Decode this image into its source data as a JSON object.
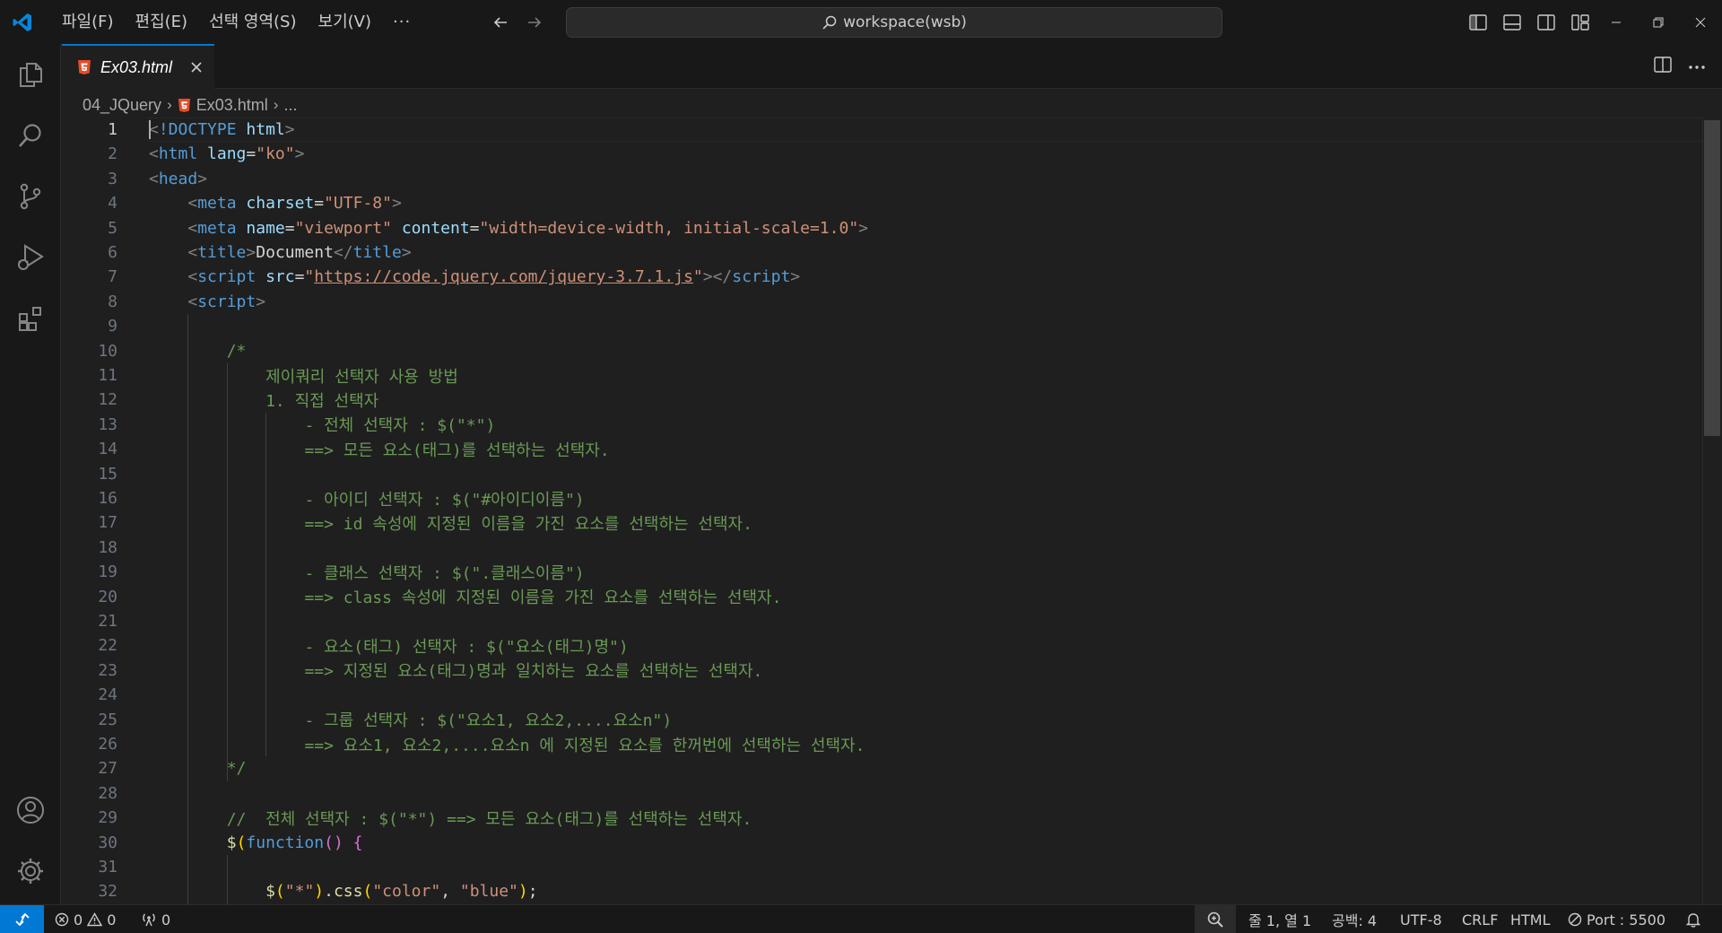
{
  "menu": {
    "items": [
      "파일(F)",
      "편집(E)",
      "선택 영역(S)",
      "보기(V)"
    ],
    "more": "···"
  },
  "command_center": {
    "text": "workspace(wsb)"
  },
  "tab": {
    "label": "Ex03.html"
  },
  "breadcrumb": {
    "folder": "04_JQuery",
    "file": "Ex03.html",
    "tail": "..."
  },
  "editor": {
    "lines": [
      {
        "n": "1",
        "indent": 0,
        "tokens": [
          [
            "punc",
            "<"
          ],
          [
            "tag",
            "!DOCTYPE "
          ],
          [
            "attr",
            "html"
          ],
          [
            "punc",
            ">"
          ]
        ]
      },
      {
        "n": "2",
        "indent": 0,
        "tokens": [
          [
            "punc",
            "<"
          ],
          [
            "tag",
            "html "
          ],
          [
            "attr",
            "lang"
          ],
          [
            "txt",
            "="
          ],
          [
            "str",
            "\"ko\""
          ],
          [
            "punc",
            ">"
          ]
        ]
      },
      {
        "n": "3",
        "indent": 0,
        "tokens": [
          [
            "punc",
            "<"
          ],
          [
            "tag",
            "head"
          ],
          [
            "punc",
            ">"
          ]
        ]
      },
      {
        "n": "4",
        "indent": 4,
        "tokens": [
          [
            "punc",
            "<"
          ],
          [
            "tag",
            "meta "
          ],
          [
            "attr",
            "charset"
          ],
          [
            "txt",
            "="
          ],
          [
            "str",
            "\"UTF-8\""
          ],
          [
            "punc",
            ">"
          ]
        ]
      },
      {
        "n": "5",
        "indent": 4,
        "tokens": [
          [
            "punc",
            "<"
          ],
          [
            "tag",
            "meta "
          ],
          [
            "attr",
            "name"
          ],
          [
            "txt",
            "="
          ],
          [
            "str",
            "\"viewport\" "
          ],
          [
            "attr",
            "content"
          ],
          [
            "txt",
            "="
          ],
          [
            "str",
            "\"width=device-width, initial-scale=1.0\""
          ],
          [
            "punc",
            ">"
          ]
        ]
      },
      {
        "n": "6",
        "indent": 4,
        "tokens": [
          [
            "punc",
            "<"
          ],
          [
            "tag",
            "title"
          ],
          [
            "punc",
            ">"
          ],
          [
            "txt",
            "Document"
          ],
          [
            "punc",
            "</"
          ],
          [
            "tag",
            "title"
          ],
          [
            "punc",
            ">"
          ]
        ]
      },
      {
        "n": "7",
        "indent": 4,
        "tokens": [
          [
            "punc",
            "<"
          ],
          [
            "tag",
            "script "
          ],
          [
            "attr",
            "src"
          ],
          [
            "txt",
            "="
          ],
          [
            "str",
            "\""
          ],
          [
            "link",
            "https://code.jquery.com/jquery-3.7.1.js"
          ],
          [
            "str",
            "\""
          ],
          [
            "punc",
            "></"
          ],
          [
            "tag",
            "script"
          ],
          [
            "punc",
            ">"
          ]
        ]
      },
      {
        "n": "8",
        "indent": 4,
        "tokens": [
          [
            "punc",
            "<"
          ],
          [
            "tag",
            "script"
          ],
          [
            "punc",
            ">"
          ]
        ]
      },
      {
        "n": "9",
        "indent": 0,
        "tokens": []
      },
      {
        "n": "10",
        "indent": 8,
        "tokens": [
          [
            "cmt",
            "/*"
          ]
        ]
      },
      {
        "n": "11",
        "indent": 12,
        "tokens": [
          [
            "cmt",
            "제이쿼리 선택자 사용 방법"
          ]
        ]
      },
      {
        "n": "12",
        "indent": 12,
        "tokens": [
          [
            "cmt",
            "1. 직접 선택자"
          ]
        ]
      },
      {
        "n": "13",
        "indent": 16,
        "tokens": [
          [
            "cmt",
            "- 전체 선택자 : $(\"*\")"
          ]
        ]
      },
      {
        "n": "14",
        "indent": 16,
        "tokens": [
          [
            "cmt",
            "==> 모든 요소(태그)를 선택하는 선택자."
          ]
        ]
      },
      {
        "n": "15",
        "indent": 0,
        "tokens": []
      },
      {
        "n": "16",
        "indent": 16,
        "tokens": [
          [
            "cmt",
            "- 아이디 선택자 : $(\"#아이디이름\")"
          ]
        ]
      },
      {
        "n": "17",
        "indent": 16,
        "tokens": [
          [
            "cmt",
            "==> id 속성에 지정된 이름을 가진 요소를 선택하는 선택자."
          ]
        ]
      },
      {
        "n": "18",
        "indent": 0,
        "tokens": []
      },
      {
        "n": "19",
        "indent": 16,
        "tokens": [
          [
            "cmt",
            "- 클래스 선택자 : $(\".클래스이름\")"
          ]
        ]
      },
      {
        "n": "20",
        "indent": 16,
        "tokens": [
          [
            "cmt",
            "==> class 속성에 지정된 이름을 가진 요소를 선택하는 선택자."
          ]
        ]
      },
      {
        "n": "21",
        "indent": 0,
        "tokens": []
      },
      {
        "n": "22",
        "indent": 16,
        "tokens": [
          [
            "cmt",
            "- 요소(태그) 선택자 : $(\"요소(태그)명\")"
          ]
        ]
      },
      {
        "n": "23",
        "indent": 16,
        "tokens": [
          [
            "cmt",
            "==> 지정된 요소(태그)명과 일치하는 요소를 선택하는 선택자."
          ]
        ]
      },
      {
        "n": "24",
        "indent": 0,
        "tokens": []
      },
      {
        "n": "25",
        "indent": 16,
        "tokens": [
          [
            "cmt",
            "- 그룹 선택자 : $(\"요소1, 요소2,....요소n\")"
          ]
        ]
      },
      {
        "n": "26",
        "indent": 16,
        "tokens": [
          [
            "cmt",
            "==> 요소1, 요소2,....요소n 에 지정된 요소를 한꺼번에 선택하는 선택자."
          ]
        ]
      },
      {
        "n": "27",
        "indent": 8,
        "tokens": [
          [
            "cmt",
            "*/"
          ]
        ]
      },
      {
        "n": "28",
        "indent": 0,
        "tokens": []
      },
      {
        "n": "29",
        "indent": 8,
        "tokens": [
          [
            "cmt",
            "//  전체 선택자 : $(\"*\") ==> 모든 요소(태그)를 선택하는 선택자."
          ]
        ]
      },
      {
        "n": "30",
        "indent": 8,
        "tokens": [
          [
            "fn",
            "$"
          ],
          [
            "brace1",
            "("
          ],
          [
            "kw",
            "function"
          ],
          [
            "brace2",
            "()"
          ],
          [
            "txt",
            " "
          ],
          [
            "brace2",
            "{"
          ]
        ]
      },
      {
        "n": "31",
        "indent": 0,
        "tokens": []
      },
      {
        "n": "32",
        "indent": 12,
        "tokens": [
          [
            "fn",
            "$"
          ],
          [
            "brace1",
            "("
          ],
          [
            "str",
            "\"*\""
          ],
          [
            "brace1",
            ")"
          ],
          [
            "txt",
            "."
          ],
          [
            "fn",
            "css"
          ],
          [
            "brace1",
            "("
          ],
          [
            "str",
            "\"color\""
          ],
          [
            "txt",
            ", "
          ],
          [
            "str",
            "\"blue\""
          ],
          [
            "brace1",
            ")"
          ],
          [
            "txt",
            ";"
          ]
        ]
      }
    ]
  },
  "status": {
    "errors": "0",
    "warnings": "0",
    "ports": "0",
    "cursor_pos": "줄 1, 열 1",
    "spaces": "공백: 4",
    "encoding": "UTF-8",
    "eol": "CRLF",
    "language": "HTML",
    "port": "Port : 5500"
  },
  "colors": {
    "accent": "#0078d4",
    "html_icon": "#e44d26"
  }
}
